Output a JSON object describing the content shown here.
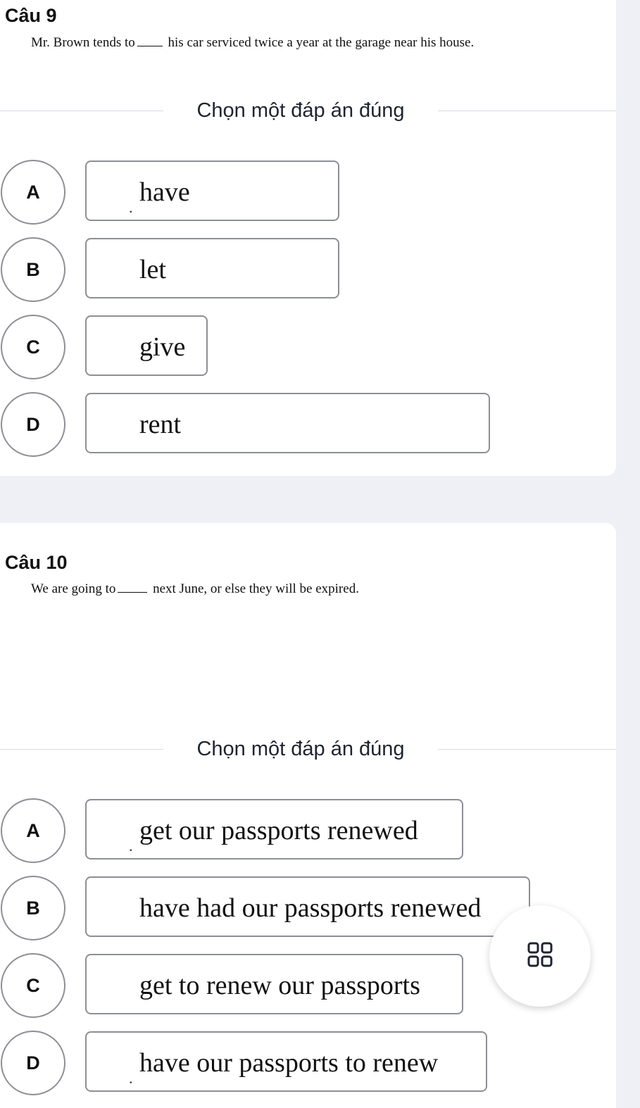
{
  "questions": [
    {
      "title": "Câu 9",
      "text_before": "Mr. Brown tends to",
      "text_after": "his car serviced twice a year at the garage near his house.",
      "instruction": "Chọn một đáp án đúng",
      "options": [
        {
          "letter": "A",
          "text": "have"
        },
        {
          "letter": "B",
          "text": "let"
        },
        {
          "letter": "C",
          "text": "give"
        },
        {
          "letter": "D",
          "text": "rent"
        }
      ]
    },
    {
      "title": "Câu 10",
      "text_before": "We are going to",
      "text_after": "next June, or else they will be expired.",
      "instruction": "Chọn một đáp án đúng",
      "options": [
        {
          "letter": "A",
          "text": "get our passports renewed"
        },
        {
          "letter": "B",
          "text": "have had our passports renewed"
        },
        {
          "letter": "C",
          "text": "get to renew our passports"
        },
        {
          "letter": "D",
          "text": "have our passports to renew"
        }
      ]
    }
  ],
  "floating_button": {
    "icon": "grid-icon"
  }
}
